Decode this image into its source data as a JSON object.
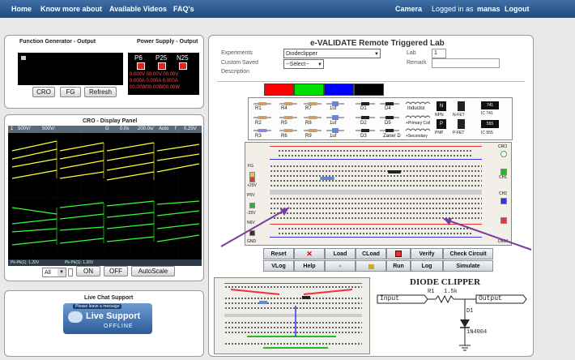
{
  "nav": {
    "home": "Home",
    "know_more": "Know more about",
    "videos": "Available Videos",
    "faq": "FAQ's",
    "camera": "Camera",
    "logged_in": "Logged in as",
    "user": "manas",
    "logout": "Logout"
  },
  "fg_panel": {
    "title_left": "Function Generator - Output",
    "title_right": "Power Supply - Output",
    "channels": [
      "P6",
      "P25",
      "N25"
    ],
    "row1": "0.000V 00.00V 00.00V",
    "row2": "0.000A 0.000A 0.000A",
    "row3": "00.00W00.00W00.00W",
    "buttons": [
      "CRO",
      "FG",
      "Refresh"
    ]
  },
  "cro_panel": {
    "title": "CRO - Display Panel",
    "top_bar": [
      "1",
      "500V/",
      "500V/",
      "G",
      "0.0s",
      "200.0s/",
      "Auto",
      "f",
      "0.25V"
    ],
    "bottom_left": "Pk-Pk(1): 1.20V",
    "bottom_right": "Pk-Pk(1): 1.20V",
    "select_value": "All",
    "on_label": "ON",
    "off_label": "OFF",
    "autoscale_label": "AutoScale"
  },
  "chat": {
    "title": "Live Chat Support",
    "leave_msg": "Please leave a message",
    "live": "Live Support",
    "offline": "OFFLINE"
  },
  "lab": {
    "title": "e-VALIDATE Remote Triggered Lab",
    "experiments_label": "Experiments",
    "experiment_value": "Diodeclipper",
    "custom_label": "Custom Saved",
    "custom_value": "--Select--",
    "description_label": "Description",
    "lab_label": "Lab",
    "lab_value": "1",
    "remark_label": "Remark",
    "remark_value": ""
  },
  "components": {
    "row1": [
      "R1",
      "R4",
      "R7",
      "1uf",
      "D1",
      "D4",
      "Inductor"
    ],
    "row2": [
      "R2",
      "R5",
      "R8",
      "1uf",
      "D2",
      "D5",
      "+Primary Coil"
    ],
    "row3": [
      "R3",
      "R6",
      "R9",
      "1uf",
      "D3",
      "Zaner D",
      "+Secondary"
    ],
    "transistors": [
      "NPN",
      "PNP",
      "N-FET",
      "P-FET"
    ],
    "ics": [
      "IC 741",
      "741",
      "555",
      "IC 555"
    ],
    "colors": [
      "#ff0000",
      "#00dd00",
      "#0000ff",
      "#000000"
    ]
  },
  "board": {
    "left_labels": [
      "FG",
      "+25V",
      "P6V",
      "-25V",
      "N6V",
      "GND"
    ],
    "right_labels": [
      "CRO",
      "CH1",
      "CH2",
      "DMM"
    ]
  },
  "toolbar": {
    "row1": [
      "Reset",
      "",
      "Load",
      "CLoad",
      "",
      "Verify",
      "Check Circuit"
    ],
    "row2": [
      "VLog",
      "Help",
      "",
      "",
      "Run",
      "Log",
      "Simulate"
    ]
  },
  "schematic": {
    "title": "DIODE CLIPPER",
    "r_label": "R1",
    "r_value": "1.5k",
    "d_label": "D1",
    "d_value": "1N4004",
    "input": "Input",
    "output": "Output"
  }
}
